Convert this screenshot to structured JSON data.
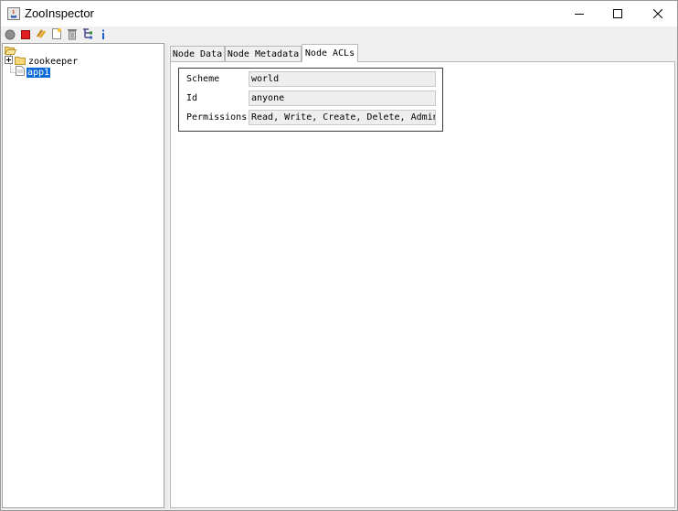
{
  "window": {
    "title": "ZooInspector",
    "controls": [
      "minimize-icon",
      "maximize-icon",
      "close-icon"
    ]
  },
  "toolbar": {
    "buttons": [
      {
        "icon": "connect-icon"
      },
      {
        "icon": "disconnect-icon"
      },
      {
        "icon": "refresh-icon"
      },
      {
        "icon": "add-node-icon"
      },
      {
        "icon": "delete-node-icon"
      },
      {
        "icon": "node-viewers-icon"
      },
      {
        "icon": "about-icon"
      }
    ]
  },
  "tree": {
    "root_icon": "open-folder-icon",
    "nodes": [
      {
        "label": "zookeeper",
        "expanded": false,
        "icon": "folder-icon"
      },
      {
        "label": "app1",
        "selected": true,
        "icon": "file-icon"
      }
    ]
  },
  "tabs": [
    {
      "label": "Node Data"
    },
    {
      "label": "Node Metadata"
    },
    {
      "label": "Node ACLs",
      "active": true
    }
  ],
  "acl": {
    "scheme_label": "Scheme",
    "scheme_value": "world",
    "id_label": "Id",
    "id_value": "anyone",
    "permissions_label": "Permissions",
    "permissions_value": "Read, Write, Create, Delete, Admin"
  },
  "colors": {
    "selection": "#0a6ad6",
    "window_bg": "#f0f0f0"
  }
}
